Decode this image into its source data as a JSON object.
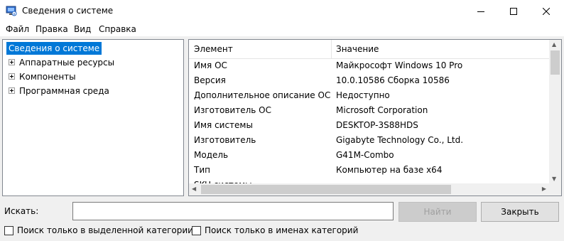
{
  "window": {
    "title": "Сведения о системе",
    "icon": "system-info-icon"
  },
  "window_controls": {
    "minimize": "–",
    "maximize": "☐",
    "close": "✕"
  },
  "menu": [
    "Файл",
    "Правка",
    "Вид",
    "Справка"
  ],
  "tree": {
    "root": "Сведения о системе",
    "children": [
      "Аппаратные ресурсы",
      "Компоненты",
      "Программная среда"
    ]
  },
  "table": {
    "columns": [
      "Элемент",
      "Значение"
    ],
    "rows": [
      {
        "element": "Имя ОС",
        "value": "Майкрософт Windows 10 Pro"
      },
      {
        "element": "Версия",
        "value": "10.0.10586 Сборка 10586"
      },
      {
        "element": "Дополнительное описание ОС",
        "value": "Недоступно"
      },
      {
        "element": "Изготовитель ОС",
        "value": "Microsoft Corporation"
      },
      {
        "element": "Имя системы",
        "value": "DESKTOP-3S88HDS"
      },
      {
        "element": "Изготовитель",
        "value": "Gigabyte Technology Co., Ltd."
      },
      {
        "element": "Модель",
        "value": "G41M-Combo"
      },
      {
        "element": "Тип",
        "value": "Компьютер на базе x64"
      },
      {
        "element": "SKU системы",
        "value": ""
      }
    ]
  },
  "search": {
    "label": "Искать:",
    "value": "",
    "find_button": "Найти",
    "close_button": "Закрыть"
  },
  "options": {
    "selected_category_only": "Поиск только в выделенной категории",
    "category_names_only": "Поиск только в именах категорий"
  },
  "colors": {
    "selection": "#0078d7"
  }
}
